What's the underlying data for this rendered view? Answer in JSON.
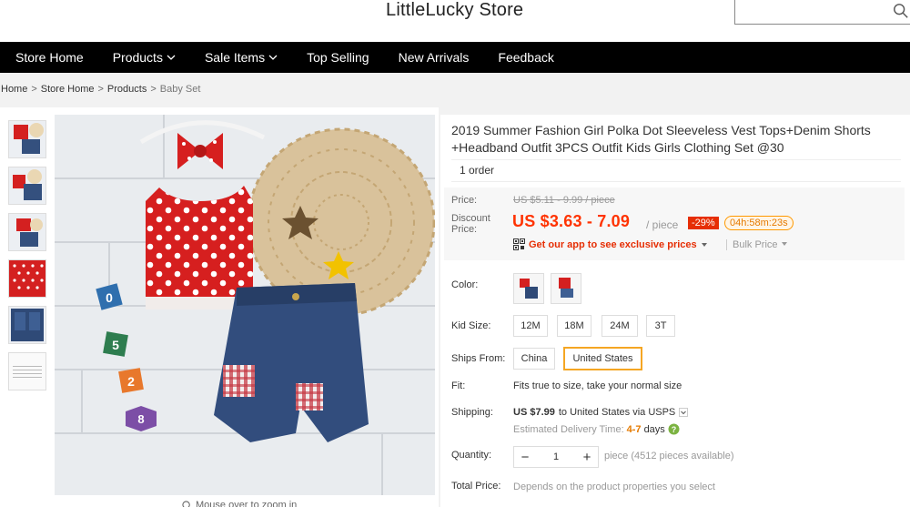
{
  "store": {
    "title": "LittleLucky Store",
    "search_placeholder": ""
  },
  "nav": [
    {
      "label": "Store Home",
      "dropdown": false
    },
    {
      "label": "Products",
      "dropdown": true
    },
    {
      "label": "Sale Items",
      "dropdown": true
    },
    {
      "label": "Top Selling",
      "dropdown": false
    },
    {
      "label": "New Arrivals",
      "dropdown": false
    },
    {
      "label": "Feedback",
      "dropdown": false
    }
  ],
  "breadcrumb": [
    "Home",
    "Store Home",
    "Products",
    "Baby Set"
  ],
  "gallery": {
    "zoom_hint": "Mouse over to zoom in"
  },
  "product": {
    "title": "2019 Summer Fashion Girl Polka Dot Sleeveless Vest Tops+Denim Shorts +Headband Outfit 3PCS Outfit Kids Girls Clothing Set @30",
    "orders": "1 order",
    "price_label": "Price:",
    "original_price": "US $5.11 - 9.99 / piece",
    "discount_label": "Discount Price:",
    "discount_price": "US $3.63 - 7.09",
    "unit": "/ piece",
    "discount_pct": "-29%",
    "countdown": "04h:58m:23s",
    "app_promo": "Get our app to see exclusive prices",
    "bulk_price": "Bulk Price",
    "color_label": "Color:",
    "kid_size_label": "Kid Size:",
    "sizes": [
      "12M",
      "18M",
      "24M",
      "3T"
    ],
    "ships_from_label": "Ships From:",
    "ships_from": [
      "China",
      "United States"
    ],
    "ships_from_selected": "United States",
    "fit_label": "Fit:",
    "fit_text": "Fits true to size, take your normal size",
    "shipping_label": "Shipping:",
    "shipping_cost": "US $7.99",
    "shipping_dest": "to United States via USPS",
    "delivery_label": "Estimated Delivery Time:",
    "delivery_days": "4-7",
    "delivery_unit": "days",
    "quantity_label": "Quantity:",
    "quantity_value": "1",
    "quantity_note": "piece (4512 pieces available)",
    "total_label": "Total Price:",
    "total_text": "Depends on the product properties you select"
  },
  "colors": {
    "accent": "#f30",
    "discount_bg": "#e62e04",
    "selected_border": "#f5a623",
    "nav_bg": "#000000"
  }
}
